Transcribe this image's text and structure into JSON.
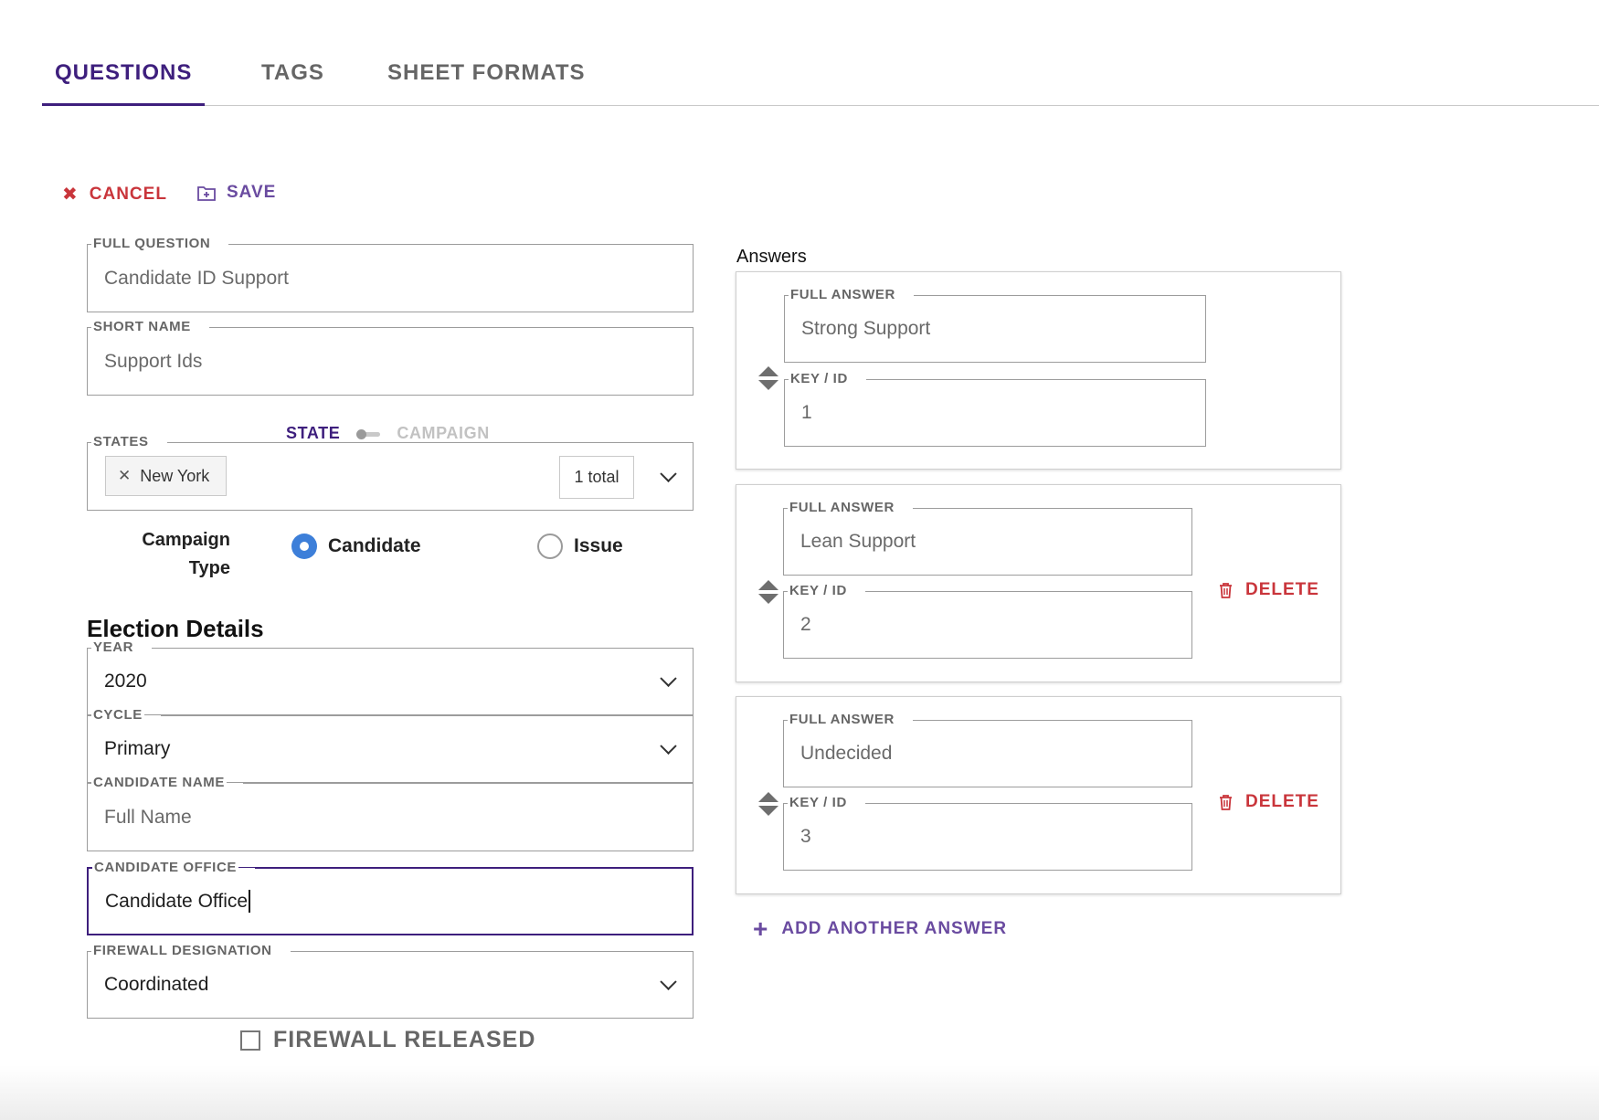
{
  "tabs": [
    {
      "label": "QUESTIONS",
      "active": true
    },
    {
      "label": "TAGS",
      "active": false
    },
    {
      "label": "SHEET FORMATS",
      "active": false
    }
  ],
  "actions": {
    "cancel": "CANCEL",
    "save": "SAVE"
  },
  "question": {
    "full_question": {
      "label": "FULL QUESTION",
      "value": "Candidate ID Support"
    },
    "short_name": {
      "label": "SHORT NAME",
      "value": "Support Ids"
    },
    "scope_toggle": {
      "left": "STATE",
      "right": "CAMPAIGN",
      "selected": "STATE"
    },
    "states": {
      "label": "STATES",
      "chips": [
        "New York"
      ],
      "total": "1 total"
    },
    "campaign_type": {
      "label_line1": "Campaign",
      "label_line2": "Type",
      "options": [
        "Candidate",
        "Issue"
      ],
      "selected": "Candidate"
    },
    "election_details_title": "Election Details",
    "year": {
      "label": "YEAR",
      "value": "2020"
    },
    "cycle": {
      "label": "CYCLE",
      "value": "Primary"
    },
    "candidate_name": {
      "label": "CANDIDATE NAME",
      "placeholder": "Full Name"
    },
    "candidate_office": {
      "label": "CANDIDATE OFFICE",
      "value": "Candidate Office"
    },
    "firewall_designation": {
      "label": "FIREWALL DESIGNATION",
      "value": "Coordinated"
    },
    "firewall_released": {
      "label": "FIREWALL RELEASED",
      "checked": false
    }
  },
  "answers": {
    "title": "Answers",
    "full_answer_label": "FULL ANSWER",
    "key_label": "KEY / ID",
    "delete_label": "DELETE",
    "items": [
      {
        "full_answer": "Strong Support",
        "key": "1"
      },
      {
        "full_answer": "Lean Support",
        "key": "2"
      },
      {
        "full_answer": "Undecided",
        "key": "3"
      }
    ],
    "add_label": "ADD ANOTHER ANSWER"
  },
  "colors": {
    "primary": "#3e1f7d",
    "accent": "#6a4ba0",
    "danger": "#c9353b",
    "radio": "#3d7fd9"
  },
  "icons": {
    "cancel": "close-icon",
    "save": "save-folder-icon",
    "delete": "trash-icon",
    "add": "plus-icon",
    "drag": "drag-handle-icon"
  }
}
